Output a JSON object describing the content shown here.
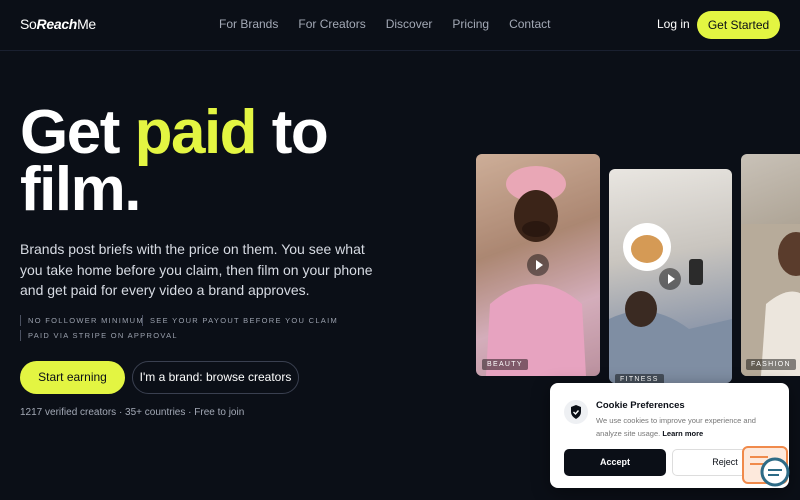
{
  "brand": {
    "logo_prefix": "So",
    "logo_main": "Reach",
    "logo_suffix": "Me"
  },
  "nav": {
    "links": [
      "For Brands",
      "For Creators",
      "Discover",
      "Pricing",
      "Contact"
    ],
    "login": "Log in",
    "get_started": "Get Started"
  },
  "hero": {
    "headline_1": "Get ",
    "headline_accent": "paid",
    "headline_2": " to film.",
    "description": "Brands post briefs with the price on them. You see what you take home before you claim, then film on your phone and get paid for every video a brand approves.",
    "features": [
      "NO FOLLOWER MINIMUM",
      "SEE YOUR PAYOUT BEFORE YOU CLAIM",
      "PAID VIA STRIPE ON APPROVAL"
    ],
    "primary_cta": "Start earning",
    "secondary_cta": "I'm a brand: browse creators",
    "stats": "1217 verified creators · 35+ countries · Free to join"
  },
  "videos": [
    {
      "tag": "BEAUTY"
    },
    {
      "tag": "FITNESS"
    },
    {
      "tag": "FASHION"
    }
  ],
  "cookie": {
    "title": "Cookie Preferences",
    "text": "We use cookies to improve your experience and analyze site usage.",
    "learn_more": "Learn more",
    "accept": "Accept",
    "reject": "Reject"
  },
  "colors": {
    "accent": "#e3f542",
    "background": "#0b0f17"
  },
  "icons": {
    "shield": "shield-check-icon",
    "play": "play-icon",
    "chat": "chat-widget-icon"
  }
}
